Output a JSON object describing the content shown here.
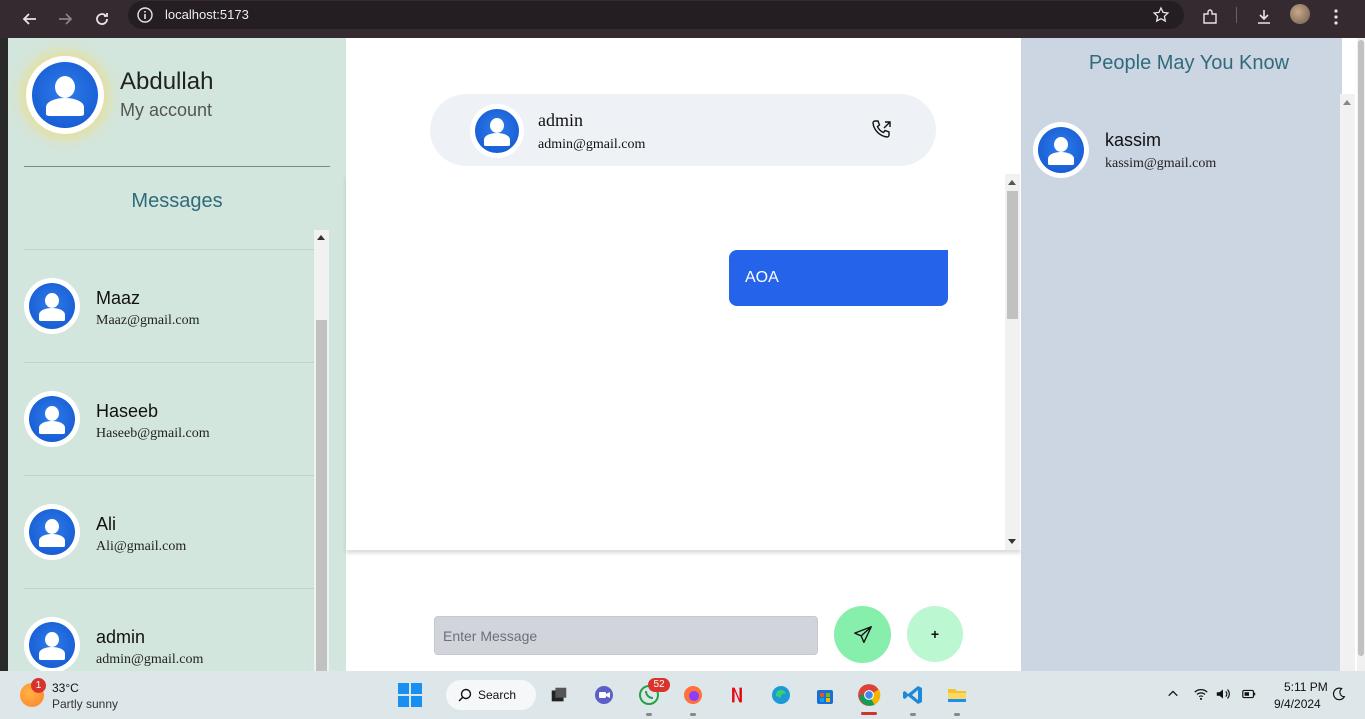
{
  "browser": {
    "url": "localhost:5173"
  },
  "left": {
    "profile": {
      "name": "Abdullah",
      "subtitle": "My account"
    },
    "messages_title": "Messages",
    "contacts": [
      {
        "name": "Maaz",
        "email": "Maaz@gmail.com"
      },
      {
        "name": "Haseeb",
        "email": "Haseeb@gmail.com"
      },
      {
        "name": "Ali",
        "email": "Ali@gmail.com"
      },
      {
        "name": "admin",
        "email": "admin@gmail.com"
      }
    ]
  },
  "chat": {
    "header": {
      "name": "admin",
      "email": "admin@gmail.com"
    },
    "messages": [
      {
        "text": "AOA",
        "side": "right"
      }
    ],
    "input_placeholder": "Enter Message",
    "plus_label": "+"
  },
  "right": {
    "title": "People May You Know",
    "people": [
      {
        "name": "kassim",
        "email": "kassim@gmail.com"
      }
    ]
  },
  "taskbar": {
    "weather": {
      "badge": "1",
      "temp": "33°C",
      "desc": "Partly sunny"
    },
    "search_label": "Search",
    "whatsapp_badge": "52",
    "time": "5:11 PM",
    "date": "9/4/2024"
  },
  "colors": {
    "left_bg": "#d3e6dd",
    "right_bg": "#ccd5e2",
    "bubble": "#2563eb",
    "send_btn": "#86efac",
    "plus_btn": "#bbf7d0",
    "title_text": "#2f6b7c"
  }
}
